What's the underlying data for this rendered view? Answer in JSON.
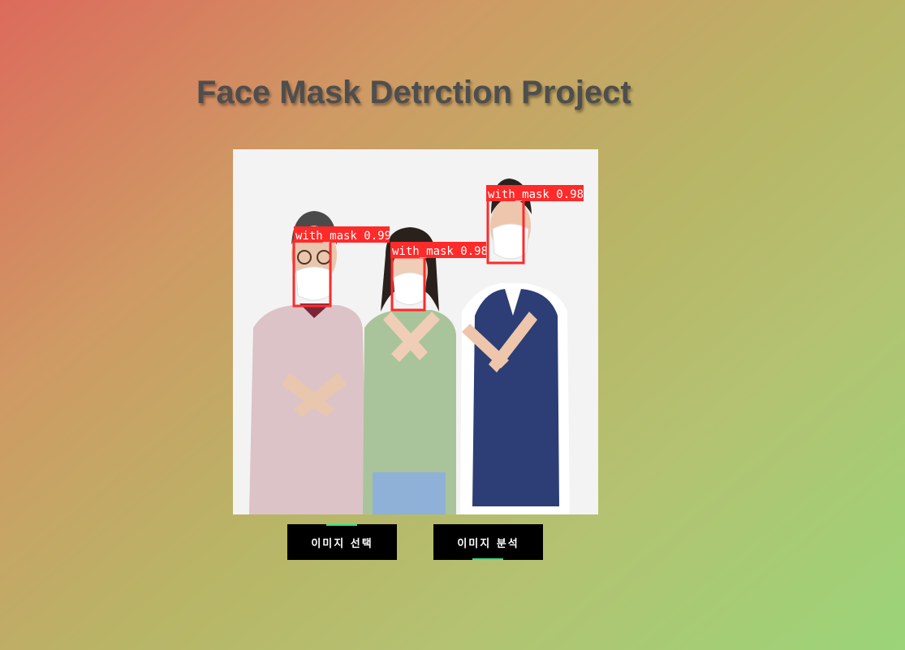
{
  "page": {
    "title": "Face Mask Detrction Project"
  },
  "image": {
    "detections": [
      {
        "label": "with_mask 0.99"
      },
      {
        "label": "with_mask 0.98"
      },
      {
        "label": "with_mask 0.98"
      }
    ],
    "box_color": "#ff2a2a"
  },
  "buttons": {
    "select_label": "이미지 선택",
    "analyze_label": "이미지 분석",
    "accent_color": "#2fe08a"
  }
}
